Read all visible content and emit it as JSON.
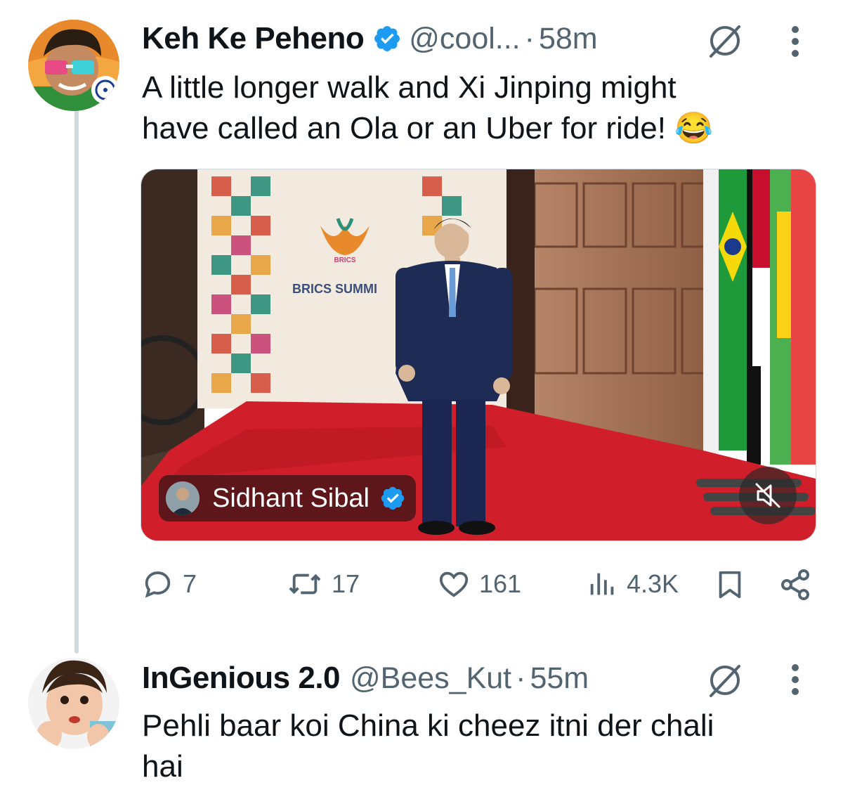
{
  "thread": [
    {
      "author_name": "Keh Ke Peheno",
      "handle": "@cool...",
      "separator": "·",
      "time": "58m",
      "verified": true,
      "text_line1": "A little longer walk and Xi Jinping might",
      "text_line2": "have called an Ola or an Uber for ride!",
      "emoji": "😂",
      "media": {
        "backdrop_text": "BRICS SUMMI",
        "logo_text": "BRICS",
        "overlay_user": "Sidhant Sibal",
        "mute_icon": "speaker-muted-icon"
      },
      "actions": {
        "replies": "7",
        "reposts": "17",
        "likes": "161",
        "views": "4.3K"
      }
    },
    {
      "author_name": "InGenious 2.0",
      "handle": "@Bees_Kut",
      "separator": "·",
      "time": "55m",
      "verified": false,
      "text_line1": "Pehli baar koi China ki cheez itni der chali",
      "text_line2": "hai"
    }
  ],
  "colors": {
    "text": "#0f1419",
    "secondary": "#536471",
    "verified_blue": "#1d9bf0",
    "thread_line": "#cfd9de"
  }
}
